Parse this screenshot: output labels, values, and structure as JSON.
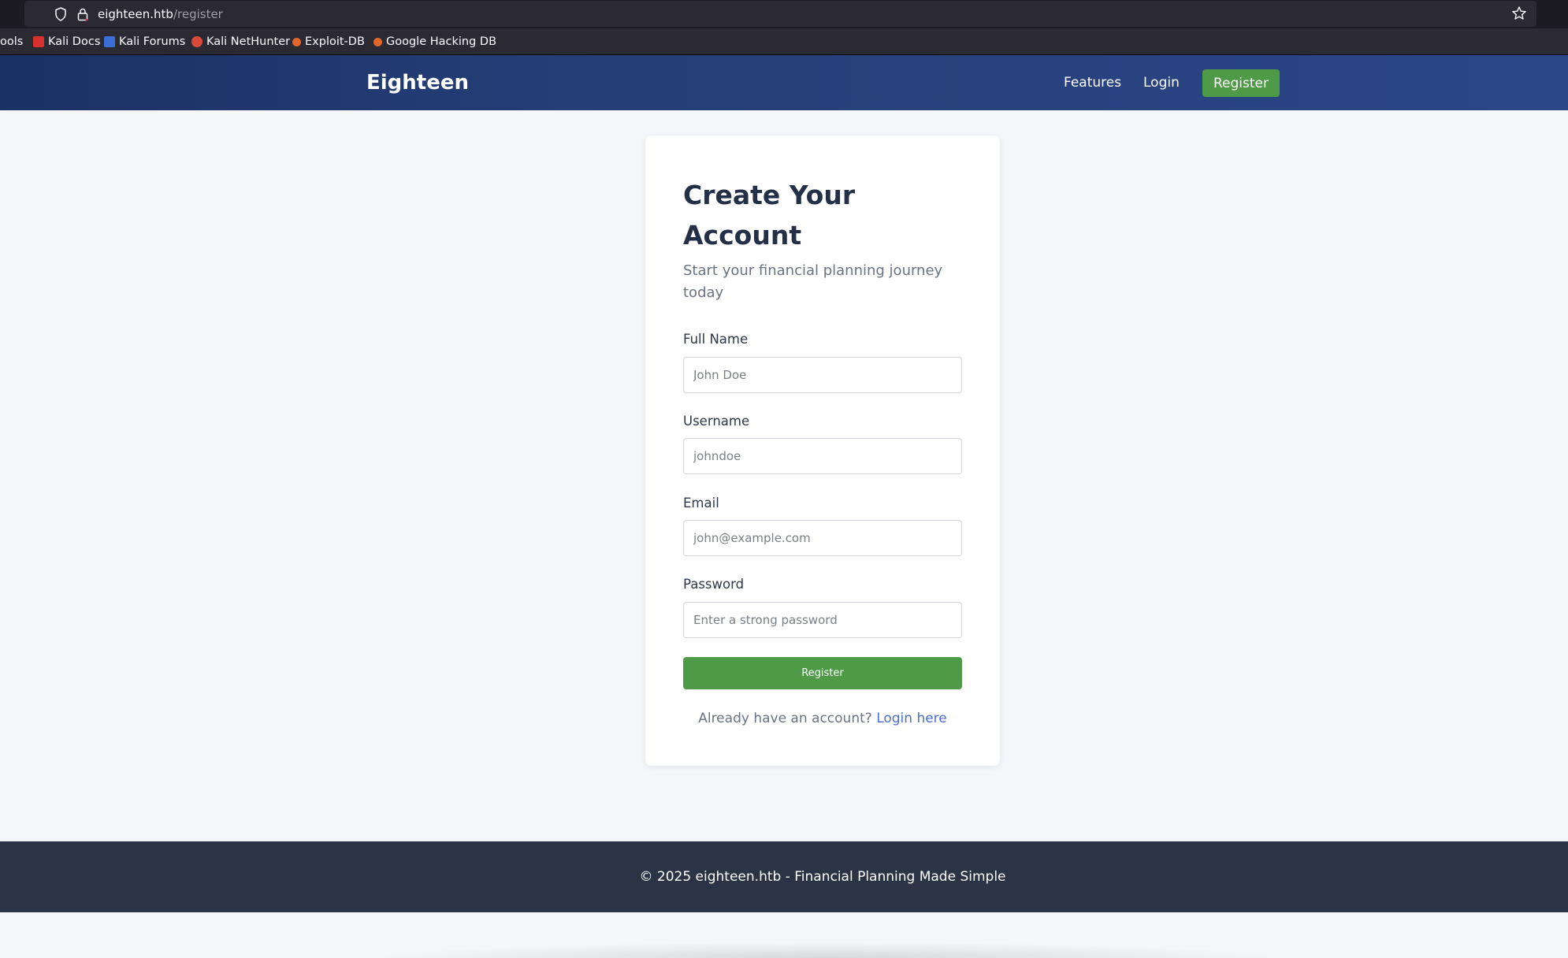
{
  "browser": {
    "url_host": "eighteen.htb",
    "url_path": "/register",
    "bookmarks": [
      {
        "label": "ools",
        "icon": "tools-icon"
      },
      {
        "label": "Kali Docs",
        "icon": "kali-docs-icon"
      },
      {
        "label": "Kali Forums",
        "icon": "kali-forums-icon"
      },
      {
        "label": "Kali NetHunter",
        "icon": "nethunter-icon"
      },
      {
        "label": "Exploit-DB",
        "icon": "exploit-db-icon"
      },
      {
        "label": "Google Hacking DB",
        "icon": "ghdb-icon"
      }
    ]
  },
  "nav": {
    "brand": "Eighteen",
    "features": "Features",
    "login": "Login",
    "register": "Register"
  },
  "form": {
    "title": "Create Your Account",
    "subtitle": "Start your financial planning journey today",
    "fullname_label": "Full Name",
    "fullname_placeholder": "John Doe",
    "username_label": "Username",
    "username_placeholder": "johndoe",
    "email_label": "Email",
    "email_placeholder": "john@example.com",
    "password_label": "Password",
    "password_placeholder": "Enter a strong password",
    "submit_label": "Register",
    "login_prompt": "Already have an account?",
    "login_link": "Login here"
  },
  "footer": {
    "text": "© 2025 eighteen.htb - Financial Planning Made Simple"
  },
  "colors": {
    "nav_start": "#1c3163",
    "nav_end": "#2b4687",
    "accent_green": "#4f9a46",
    "link_blue": "#4a6fd1",
    "footer_bg": "#2a3444"
  }
}
